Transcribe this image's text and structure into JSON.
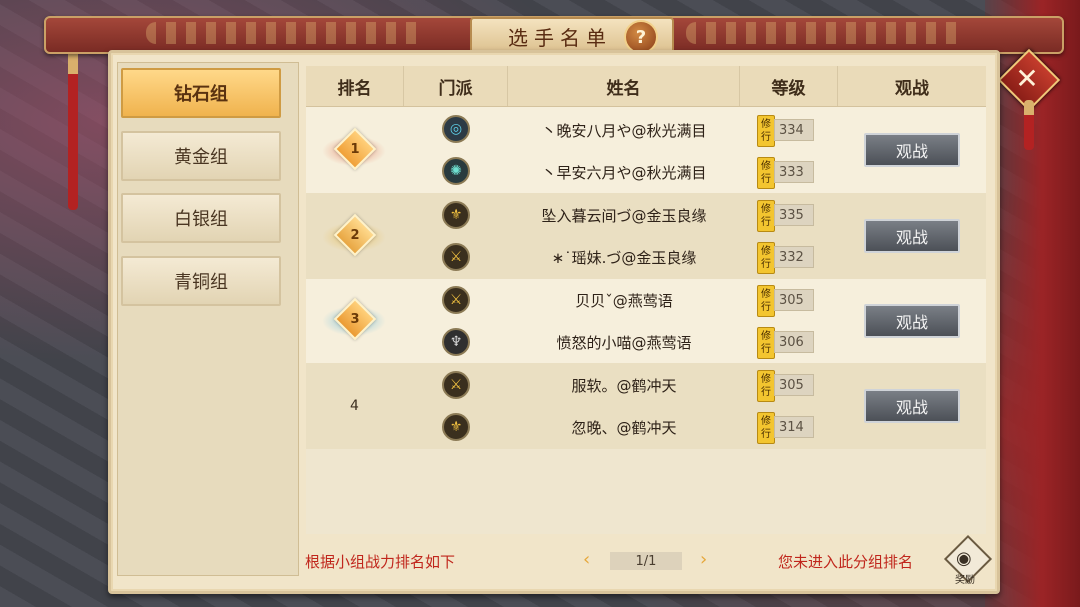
{
  "title": "选手名单",
  "help_label": "?",
  "close_label": "✕",
  "groups": [
    {
      "label": "钻石组",
      "active": true
    },
    {
      "label": "黄金组",
      "active": false
    },
    {
      "label": "白银组",
      "active": false
    },
    {
      "label": "青铜组",
      "active": false
    }
  ],
  "table": {
    "headers": [
      "排名",
      "门派",
      "姓名",
      "等级",
      "观战"
    ],
    "level_tag": [
      "修",
      "行"
    ],
    "teams": [
      {
        "rank": "1",
        "players": [
          {
            "sect_icon": "ring-icon",
            "name": "丶晚安八月や@秋光满目",
            "level": "334"
          },
          {
            "sect_icon": "swirl-icon",
            "name": "丶早安六月や@秋光满目",
            "level": "333"
          }
        ],
        "watch": "观战"
      },
      {
        "rank": "2",
        "players": [
          {
            "sect_icon": "fleur-icon",
            "name": "坠入暮云间づ@金玉良缘",
            "level": "335"
          },
          {
            "sect_icon": "sword-icon",
            "name": "∗˙瑶妹.づ@金玉良缘",
            "level": "332"
          }
        ],
        "watch": "观战"
      },
      {
        "rank": "3",
        "players": [
          {
            "sect_icon": "sword-icon",
            "name": "贝贝ˇ@燕莺语",
            "level": "305"
          },
          {
            "sect_icon": "demon-icon",
            "name": "愤怒的小喵@燕莺语",
            "level": "306"
          }
        ],
        "watch": "观战"
      },
      {
        "rank": "4",
        "players": [
          {
            "sect_icon": "sword-icon",
            "name": "服软。@鹤冲天",
            "level": "305"
          },
          {
            "sect_icon": "fleur-icon",
            "name": "忽晚、@鹤冲天",
            "level": "314"
          }
        ],
        "watch": "观战"
      }
    ]
  },
  "footer": {
    "left_text": "根据小组战力排名如下",
    "prev": "‹",
    "page": "1/1",
    "next": "›",
    "right_text": "您未进入此分组排名",
    "reward_label": "奖励"
  },
  "colors": {
    "accent_red": "#c0261c",
    "active_gold": "#f0b34e"
  }
}
